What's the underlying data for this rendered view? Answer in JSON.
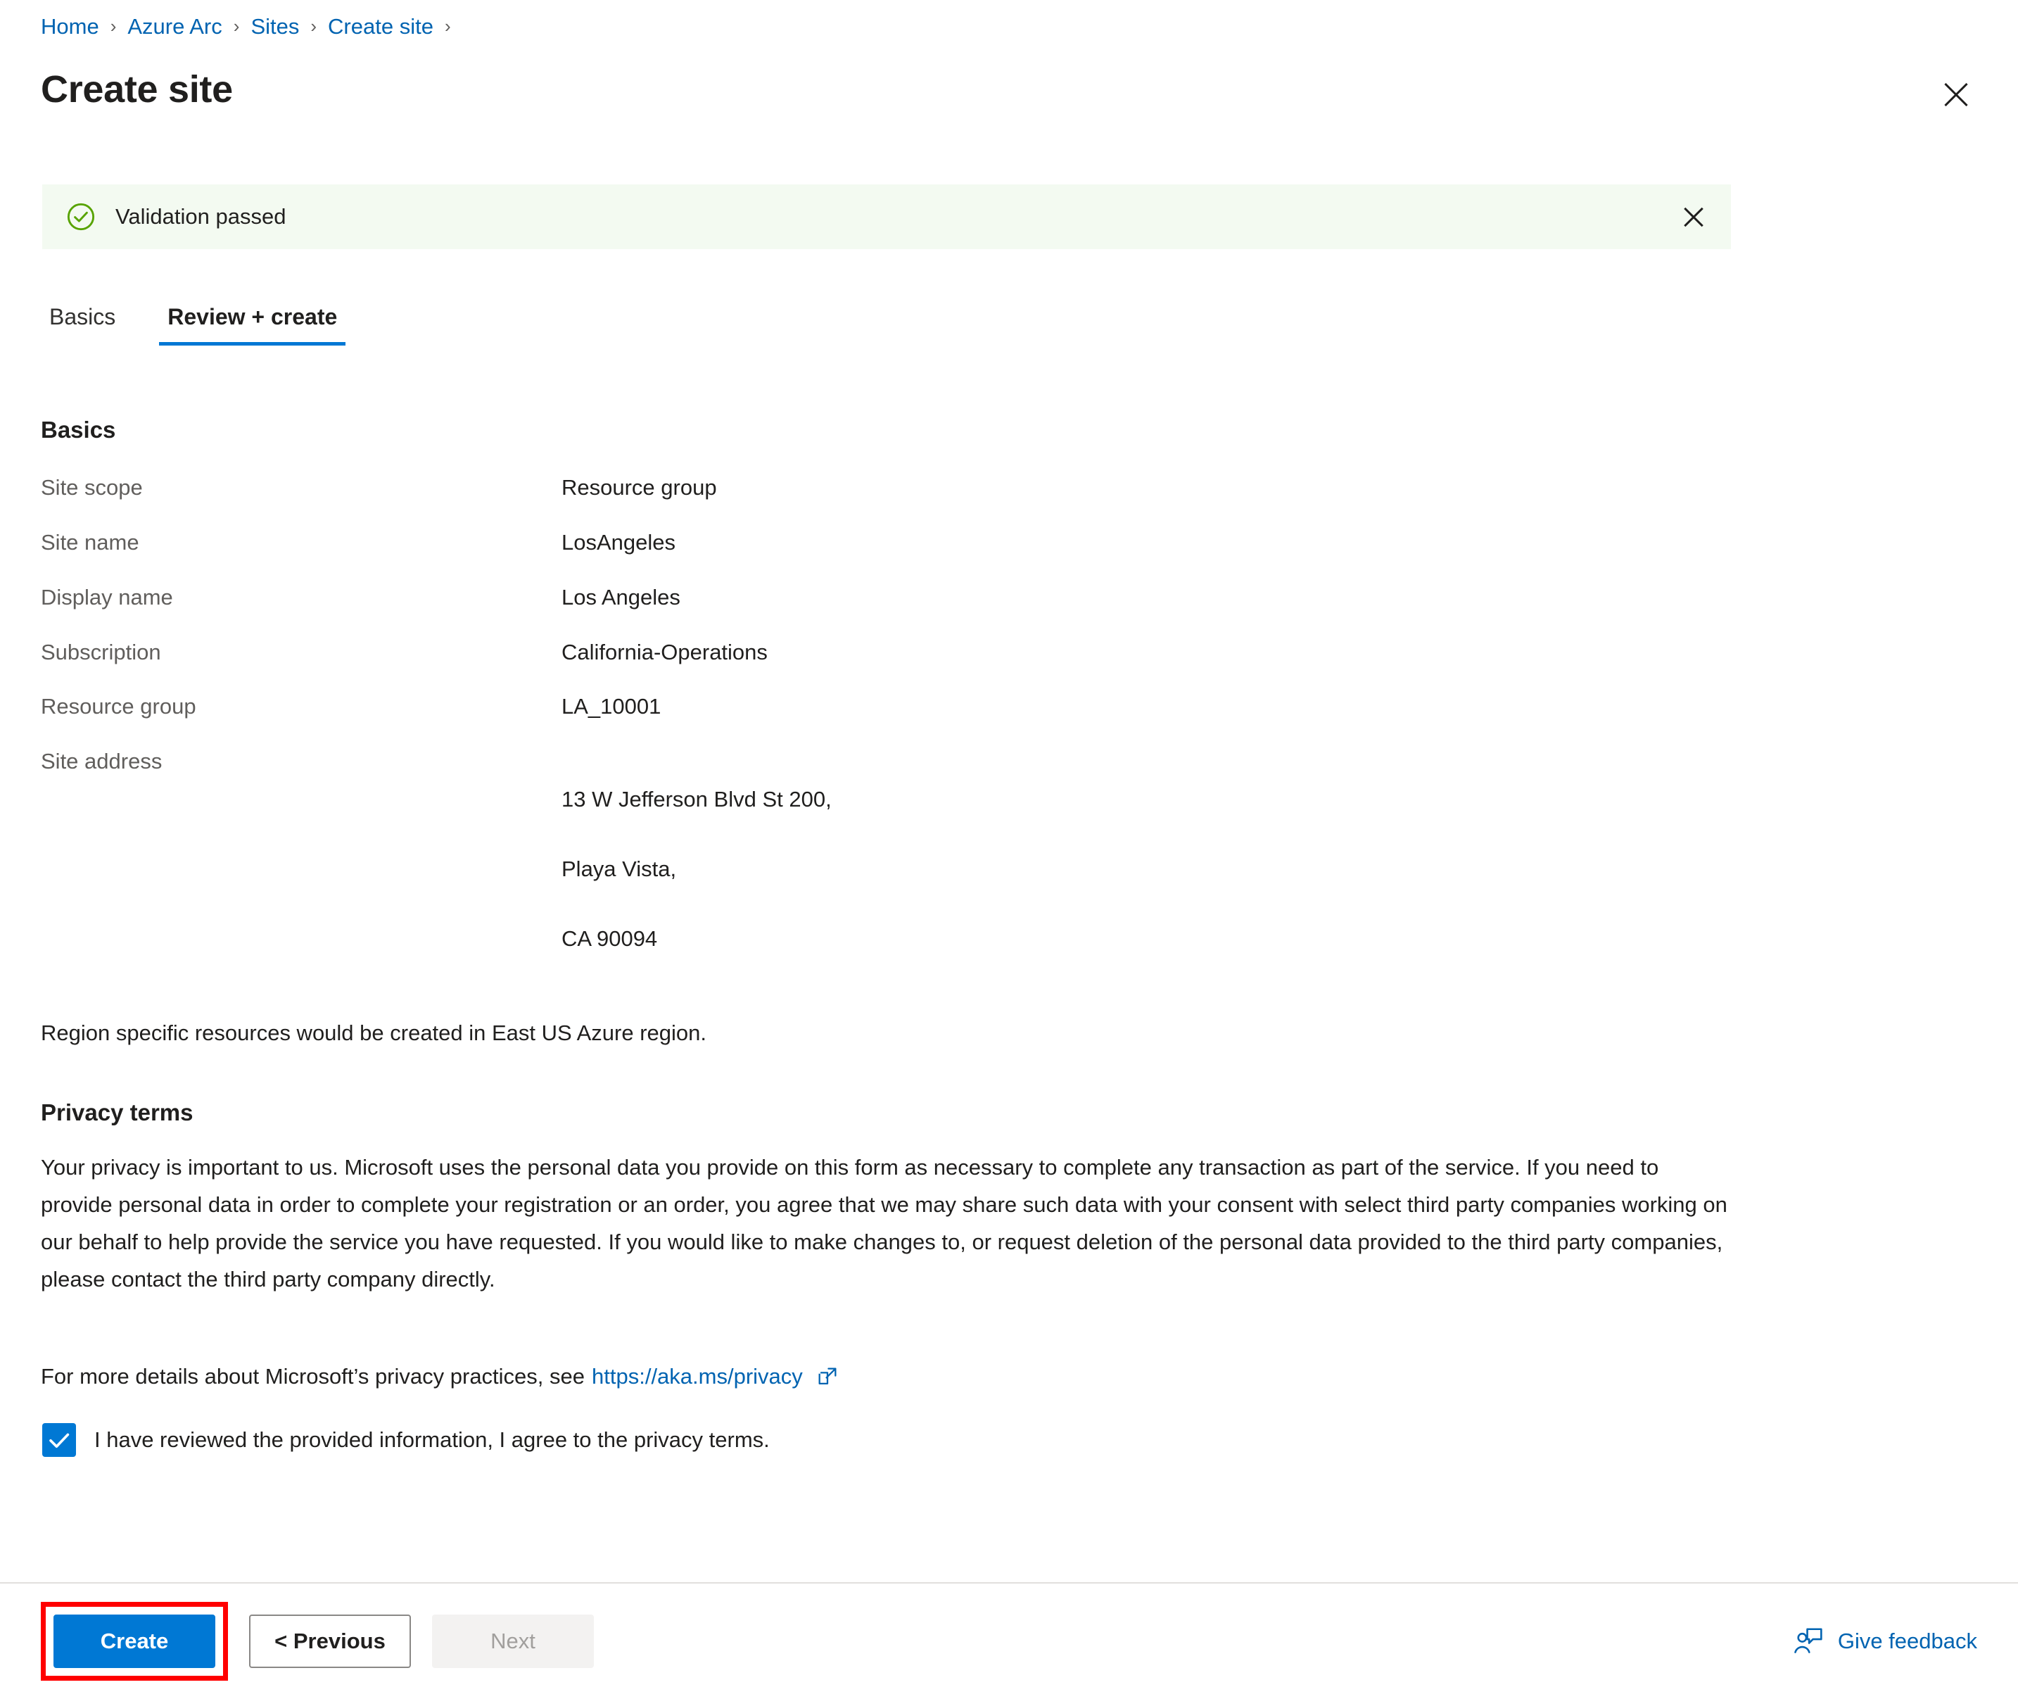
{
  "breadcrumb": {
    "items": [
      {
        "label": "Home"
      },
      {
        "label": "Azure Arc"
      },
      {
        "label": "Sites"
      },
      {
        "label": "Create site"
      }
    ],
    "separator": "›"
  },
  "header": {
    "title": "Create site",
    "close_icon": "close-icon"
  },
  "banner": {
    "icon": "check-circle-icon",
    "message": "Validation passed",
    "close_icon": "close-icon",
    "background_color": "#f3faf1",
    "icon_color": "#57a300"
  },
  "tabs": [
    {
      "label": "Basics",
      "active": false
    },
    {
      "label": "Review + create",
      "active": true
    }
  ],
  "basics": {
    "heading": "Basics",
    "rows": [
      {
        "label": "Site scope",
        "value": "Resource group"
      },
      {
        "label": "Site name",
        "value": "LosAngeles"
      },
      {
        "label": "Display name",
        "value": "Los Angeles"
      },
      {
        "label": "Subscription",
        "value": "California-Operations"
      },
      {
        "label": "Resource group",
        "value": "LA_10001"
      }
    ],
    "address_row": {
      "label": "Site address",
      "line1": "13 W Jefferson Blvd St 200,",
      "line2": "Playa Vista,",
      "line3": "CA 90094"
    }
  },
  "region_note": "Region specific resources would be created in East US Azure region.",
  "privacy": {
    "heading": "Privacy terms",
    "body": "Your privacy is important to us. Microsoft uses the personal data you provide on this form as necessary to complete any transaction as part of the service. If you need to provide personal data in order to complete your registration or an order, you agree that we may share such data with your consent with select third party companies working on our behalf to help provide the service you have requested. If you would like to make changes to, or request deletion of the personal data provided to the third party companies, please contact the third party company directly.",
    "link_prefix": "For more details about Microsoft’s privacy practices, see",
    "link_text": "https://aka.ms/privacy",
    "link_icon": "external-link-icon",
    "consent_label": "I have reviewed the provided information, I agree to the privacy terms.",
    "consent_checked": true
  },
  "footer": {
    "create_label": "Create",
    "previous_label": "< Previous",
    "next_label": "Next",
    "next_disabled": true,
    "feedback_label": "Give feedback",
    "feedback_icon": "person-feedback-icon",
    "highlight_color": "#ff0000"
  },
  "colors": {
    "accent": "#0078d4",
    "link": "#0063b1",
    "success": "#57a300",
    "text": "#201f1e",
    "muted": "#605e5c"
  }
}
